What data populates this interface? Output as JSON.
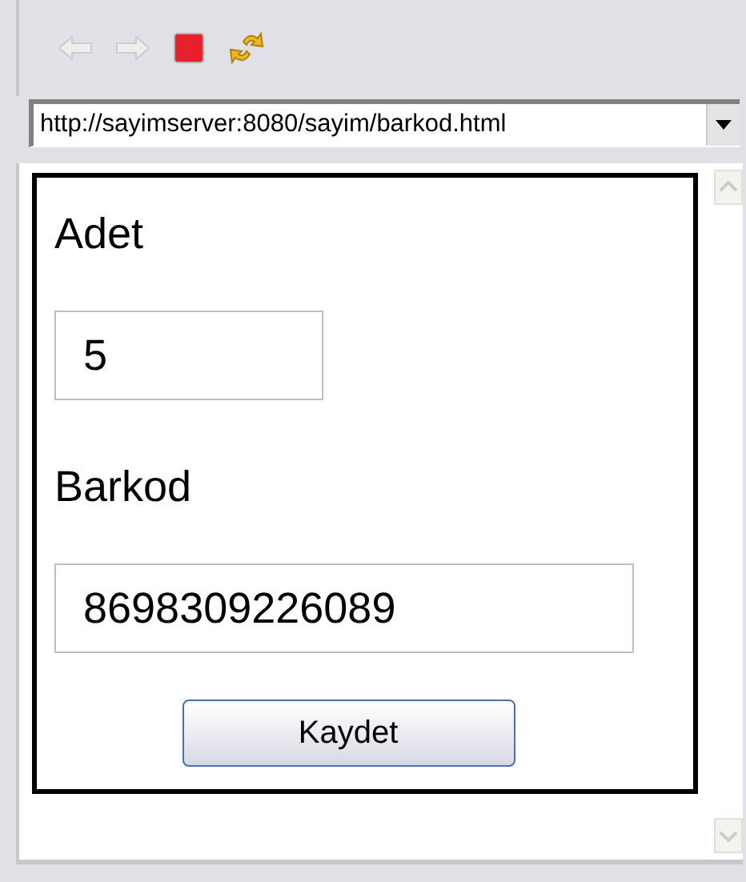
{
  "toolbar": [
    {
      "kind": "back",
      "disabled": true
    },
    {
      "kind": "forward",
      "disabled": true
    },
    {
      "kind": "stop",
      "disabled": false
    },
    {
      "kind": "refresh",
      "disabled": false
    }
  ],
  "address_bar": {
    "value": "http://sayimserver:8080/sayim/barkod.html"
  },
  "form": {
    "fields": [
      {
        "label": "Adet",
        "value": "5",
        "kind": "short"
      },
      {
        "label": "Barkod",
        "value": "8698309226089",
        "kind": "long"
      }
    ],
    "button": "Kaydet"
  }
}
